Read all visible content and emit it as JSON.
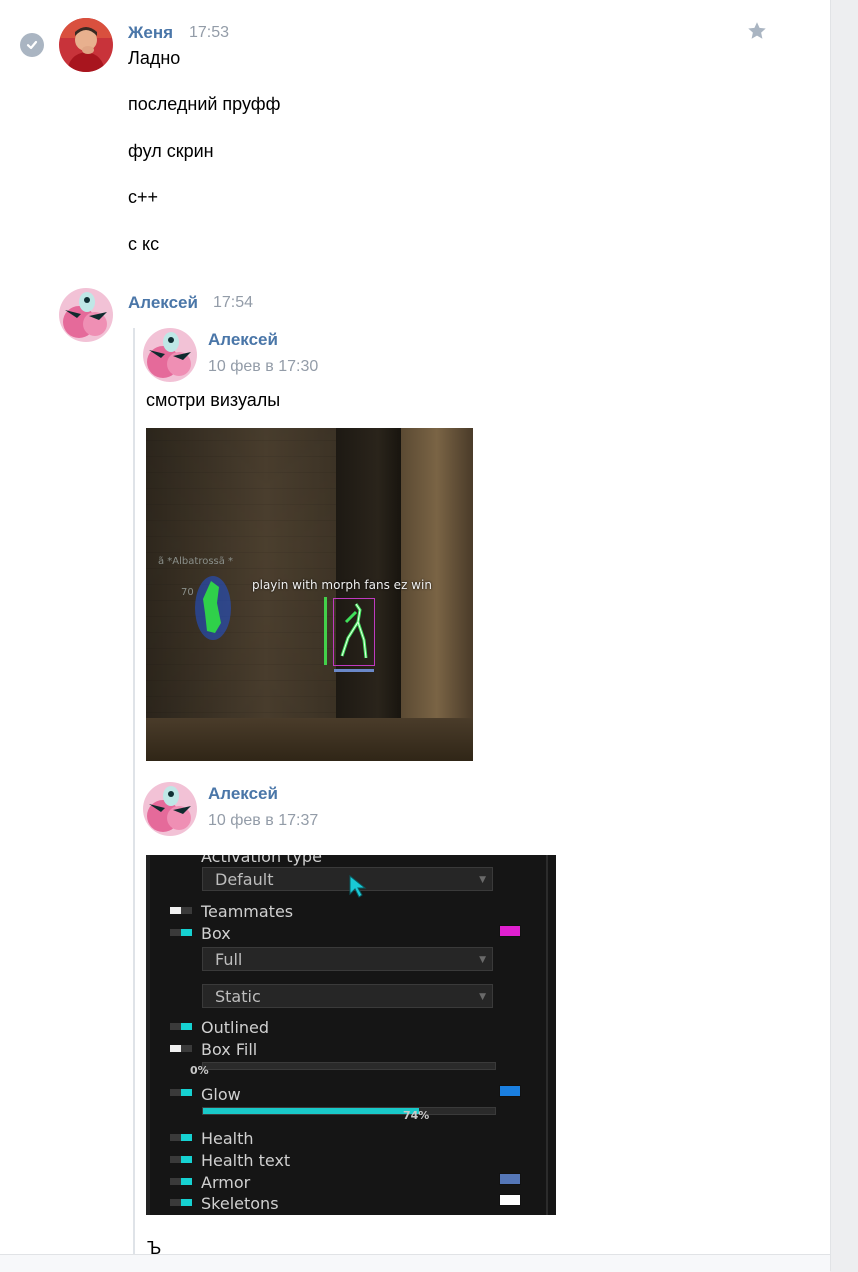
{
  "messages": [
    {
      "author": "Женя",
      "time": "17:53",
      "lines": [
        "Ладно",
        "последний пруфф",
        "фул скрин",
        "с++",
        "с кс"
      ]
    },
    {
      "author": "Алексей",
      "time": "17:54"
    }
  ],
  "forwarded": [
    {
      "author": "Алексей",
      "date": "10 фев в 17:30",
      "text": "смотри визуалы",
      "screenshot": {
        "faint_name": "ã  *Albatrossã  *",
        "faint_hp": "70",
        "esp_label": "playin with morph fans ez win"
      }
    },
    {
      "author": "Алексей",
      "date": "10 фев в 17:37",
      "menu": {
        "activation_label": "Activation type",
        "activation_value": "Default",
        "teammates": "Teammates",
        "box": "Box",
        "box_type": "Full",
        "box_mode": "Static",
        "outlined": "Outlined",
        "box_fill": "Box Fill",
        "box_fill_value": "0%",
        "box_fill_level": 0,
        "glow": "Glow",
        "glow_value": "74%",
        "glow_level": 0.74,
        "health": "Health",
        "health_text": "Health text",
        "armor": "Armor",
        "skeletons": "Skeletons",
        "colors": {
          "box": "#e020d0",
          "glow": "#1a7fe0",
          "armor": "#5577b8",
          "skeletons": "#ffffff"
        }
      }
    }
  ],
  "trailing_char": "Ъ",
  "icons": {
    "read_status": "check-circle-icon",
    "favorite": "star-icon",
    "cursor": "mouse-cursor-icon"
  },
  "colors": {
    "author": "#4a76a8",
    "time": "#939ca8",
    "accent_toggle": "#16d1d1"
  }
}
